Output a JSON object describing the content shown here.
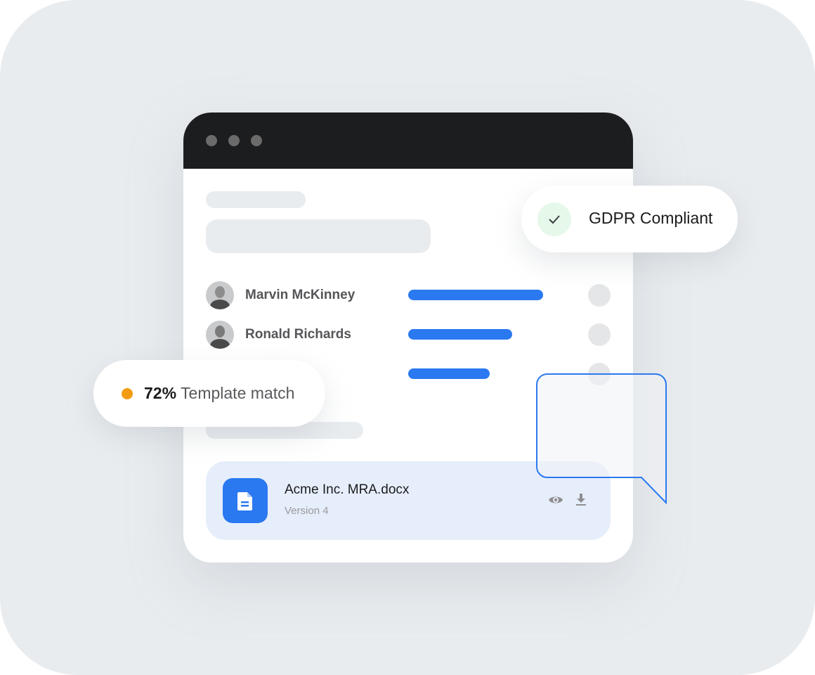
{
  "window": {
    "traffic_lights": [
      "close",
      "minimize",
      "maximize"
    ]
  },
  "people": [
    {
      "name": "Marvin McKinney",
      "progress": 0.75
    },
    {
      "name": "Ronald Richards",
      "progress": 0.58
    },
    {
      "name": "",
      "progress": 0.45
    }
  ],
  "file": {
    "name": "Acme Inc. MRA.docx",
    "version": "Version 4",
    "icon": "document-icon",
    "actions": [
      "view-icon",
      "download-icon"
    ]
  },
  "badges": {
    "gdpr": {
      "label": "GDPR Compliant",
      "icon": "check-icon",
      "color": "#e6f8ea"
    },
    "template_match": {
      "percent": "72%",
      "label": "Template match",
      "dot_color": "#f39c12"
    }
  },
  "colors": {
    "accent": "#2a79f0",
    "titlebar": "#1c1d1f",
    "background": "#e9ecef"
  }
}
